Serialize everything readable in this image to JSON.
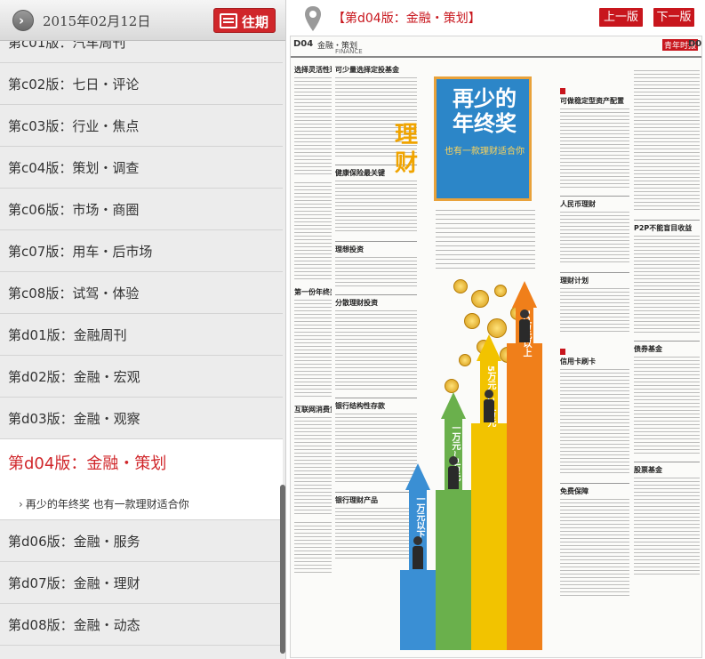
{
  "header": {
    "date": "2015年02月12日",
    "past_label": "往期"
  },
  "editions": [
    {
      "label": "第c01版：汽车周刊",
      "active": false
    },
    {
      "label": "第c02版：七日・评论",
      "active": false
    },
    {
      "label": "第c03版：行业・焦点",
      "active": false
    },
    {
      "label": "第c04版：策划・调查",
      "active": false
    },
    {
      "label": "第c06版：市场・商圈",
      "active": false
    },
    {
      "label": "第c07版：用车・后市场",
      "active": false
    },
    {
      "label": "第c08版：试驾・体验",
      "active": false
    },
    {
      "label": "第d01版：金融周刊",
      "active": false
    },
    {
      "label": "第d02版：金融・宏观",
      "active": false
    },
    {
      "label": "第d03版：金融・观察",
      "active": false
    },
    {
      "label": "第d04版：金融・策划",
      "active": true,
      "article": "再少的年终奖 也有一款理财适合你"
    },
    {
      "label": "第d06版：金融・服务",
      "active": false
    },
    {
      "label": "第d07版：金融・理财",
      "active": false
    },
    {
      "label": "第d08版：金融・动态",
      "active": false
    }
  ],
  "viewer": {
    "page_name": "【第d04版：金融・策划】",
    "prev_label": "上一版",
    "next_label": "下一版"
  },
  "newspaper": {
    "code_left": "D04",
    "section_cn": "金融・策划",
    "section_en": "FINANCE",
    "brand": "青年时报",
    "code_right": "D05",
    "big_title": "再少的年终奖",
    "big_subtitle": "也有一款理财适合你",
    "side_word": "理财",
    "steps": [
      "一万元以下",
      "一万元~5万元",
      "5万元~10万元",
      "10万元以上"
    ],
    "columns": {
      "left_headlines": [
        "选择灵活性理财",
        "第一份年终奖",
        "互联网消费贷款"
      ],
      "mid_headlines": [
        "可少量选择定投基金",
        "健康保险最关键",
        "理想投资",
        "分散理财投资",
        "银行结构性存款",
        "银行理财产品"
      ],
      "right_headlines": [
        "可做稳定型资产配置",
        "人民币理财",
        "理财计划",
        "信用卡刷卡",
        "免费保障"
      ],
      "far_headlines": [
        "P2P不能盲目收益",
        "债券基金",
        "股票基金"
      ]
    }
  },
  "colors": {
    "accent": "#c8161d",
    "past_button": "#d0262a",
    "step_colors": [
      "#3a8fd4",
      "#6ab04c",
      "#f2c300",
      "#f07f1a"
    ]
  }
}
